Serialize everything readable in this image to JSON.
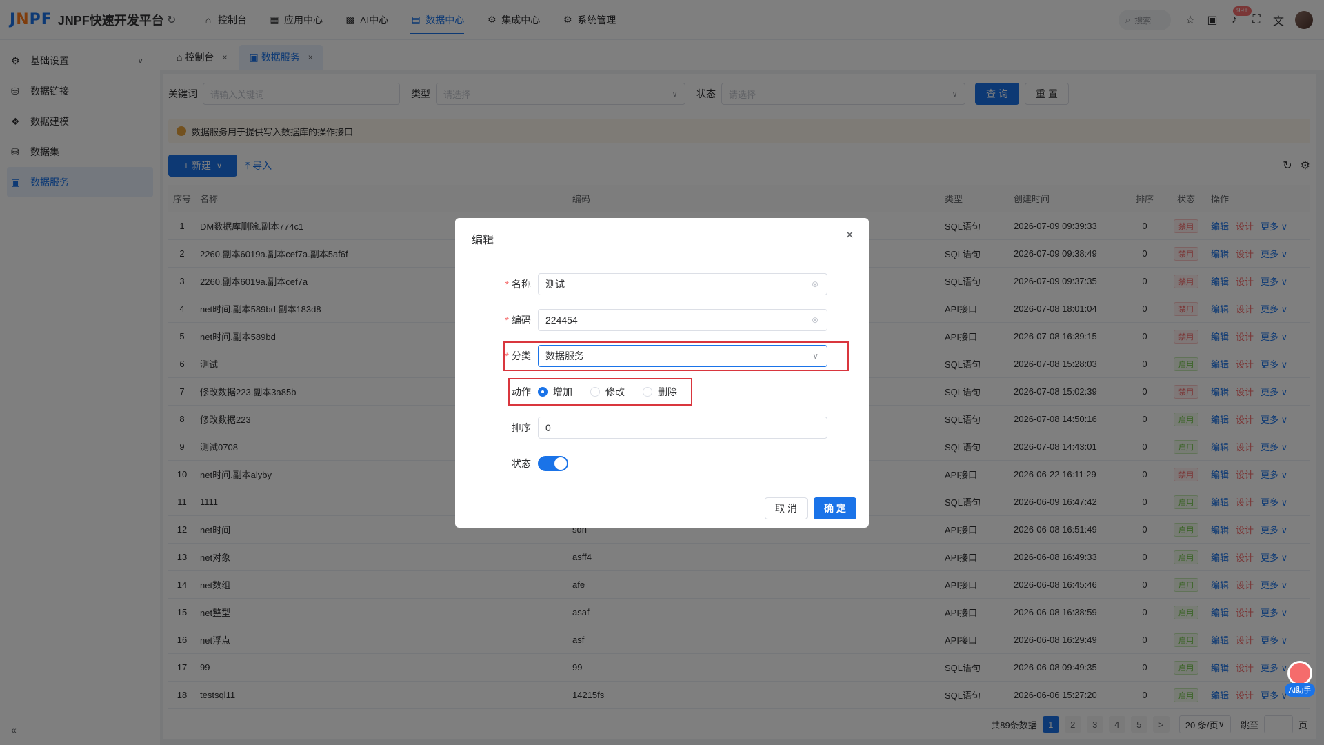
{
  "app": {
    "logo": {
      "j": "J",
      "n": "N",
      "pf": "PF"
    },
    "title": "JNPF快速开发平台"
  },
  "topnav": [
    {
      "label": "控制台",
      "icon": "home-icon",
      "glyph": "⌂"
    },
    {
      "label": "应用中心",
      "icon": "grid-icon",
      "glyph": "▦"
    },
    {
      "label": "AI中心",
      "icon": "ai-grid-icon",
      "glyph": "▩"
    },
    {
      "label": "数据中心",
      "icon": "database-icon",
      "glyph": "▤",
      "active": true
    },
    {
      "label": "集成中心",
      "icon": "integration-icon",
      "glyph": "⚙"
    },
    {
      "label": "系统管理",
      "icon": "gear-icon",
      "glyph": "⚙"
    }
  ],
  "header": {
    "search_placeholder": "搜索",
    "badge": "99+"
  },
  "sidebar": {
    "items": [
      {
        "label": "基础设置",
        "icon": "settings-icon"
      },
      {
        "label": "数据链接",
        "icon": "link-icon"
      },
      {
        "label": "数据建模",
        "icon": "model-icon"
      },
      {
        "label": "数据集",
        "icon": "dataset-icon"
      },
      {
        "label": "数据服务",
        "icon": "service-icon",
        "active": true
      }
    ]
  },
  "tabs": [
    {
      "label": "控制台",
      "close": "×"
    },
    {
      "label": "数据服务",
      "close": "×",
      "active": true
    }
  ],
  "filter": {
    "keyword_label": "关键词",
    "keyword_placeholder": "请输入关键词",
    "type_label": "类型",
    "type_placeholder": "请选择",
    "status_label": "状态",
    "status_placeholder": "请选择",
    "query_label": "查 询",
    "reset_label": "重 置"
  },
  "notice": "数据服务用于提供写入数据库的操作接口",
  "toolbar": {
    "new_label": "+ 新建",
    "import_label": "导入"
  },
  "table": {
    "headers": [
      "序号",
      "名称",
      "编码",
      "类型",
      "创建时间",
      "排序",
      "状态",
      "操作"
    ],
    "ops": {
      "edit": "编辑",
      "design": "设计",
      "more": "更多"
    },
    "rows": [
      {
        "idx": "1",
        "name": "DM数据库删除.副本774c1",
        "code": "",
        "type": "SQL语句",
        "time": "2026-07-09 09:39:33",
        "sort": "0",
        "status": "禁用"
      },
      {
        "idx": "2",
        "name": "2260.副本6019a.副本cef7a.副本5af6f",
        "code": "",
        "type": "SQL语句",
        "time": "2026-07-09 09:38:49",
        "sort": "0",
        "status": "禁用"
      },
      {
        "idx": "3",
        "name": "2260.副本6019a.副本cef7a",
        "code": "",
        "type": "SQL语句",
        "time": "2026-07-09 09:37:35",
        "sort": "0",
        "status": "禁用"
      },
      {
        "idx": "4",
        "name": "net时间.副本589bd.副本183d8",
        "code": "",
        "type": "API接口",
        "time": "2026-07-08 18:01:04",
        "sort": "0",
        "status": "禁用"
      },
      {
        "idx": "5",
        "name": "net时间.副本589bd",
        "code": "",
        "type": "API接口",
        "time": "2026-07-08 16:39:15",
        "sort": "0",
        "status": "禁用"
      },
      {
        "idx": "6",
        "name": "测试",
        "code": "",
        "type": "SQL语句",
        "time": "2026-07-08 15:28:03",
        "sort": "0",
        "status": "启用"
      },
      {
        "idx": "7",
        "name": "修改数据223.副本3a85b",
        "code": "",
        "type": "SQL语句",
        "time": "2026-07-08 15:02:39",
        "sort": "0",
        "status": "禁用"
      },
      {
        "idx": "8",
        "name": "修改数据223",
        "code": "",
        "type": "SQL语句",
        "time": "2026-07-08 14:50:16",
        "sort": "0",
        "status": "启用"
      },
      {
        "idx": "9",
        "name": "测试0708",
        "code": "",
        "type": "SQL语句",
        "time": "2026-07-08 14:43:01",
        "sort": "0",
        "status": "启用"
      },
      {
        "idx": "10",
        "name": "net时间.副本alyby",
        "code": "",
        "type": "API接口",
        "time": "2026-06-22 16:11:29",
        "sort": "0",
        "status": "禁用"
      },
      {
        "idx": "11",
        "name": "1111",
        "code": "",
        "type": "SQL语句",
        "time": "2026-06-09 16:47:42",
        "sort": "0",
        "status": "启用"
      },
      {
        "idx": "12",
        "name": "net时间",
        "code": "sdh",
        "type": "API接口",
        "time": "2026-06-08 16:51:49",
        "sort": "0",
        "status": "启用"
      },
      {
        "idx": "13",
        "name": "net对象",
        "code": "asff4",
        "type": "API接口",
        "time": "2026-06-08 16:49:33",
        "sort": "0",
        "status": "启用"
      },
      {
        "idx": "14",
        "name": "net数组",
        "code": "afe",
        "type": "API接口",
        "time": "2026-06-08 16:45:46",
        "sort": "0",
        "status": "启用"
      },
      {
        "idx": "15",
        "name": "net整型",
        "code": "asaf",
        "type": "API接口",
        "time": "2026-06-08 16:38:59",
        "sort": "0",
        "status": "启用"
      },
      {
        "idx": "16",
        "name": "net浮点",
        "code": "asf",
        "type": "API接口",
        "time": "2026-06-08 16:29:49",
        "sort": "0",
        "status": "启用"
      },
      {
        "idx": "17",
        "name": "99",
        "code": "99",
        "type": "SQL语句",
        "time": "2026-06-08 09:49:35",
        "sort": "0",
        "status": "启用"
      },
      {
        "idx": "18",
        "name": "testsql11",
        "code": "14215fs",
        "type": "SQL语句",
        "time": "2026-06-06 15:27:20",
        "sort": "0",
        "status": "启用"
      }
    ]
  },
  "pager": {
    "total": "共89条数据",
    "pages": [
      "1",
      "2",
      "3",
      "4",
      "5"
    ],
    "next": ">",
    "size": "20 条/页",
    "jump_label": "跳至",
    "page_unit": "页"
  },
  "dialog": {
    "title": "编辑",
    "name_label": "名称",
    "name_value": "测试",
    "code_label": "编码",
    "code_value": "224454",
    "category_label": "分类",
    "category_value": "数据服务",
    "action_label": "动作",
    "actions": [
      "增加",
      "修改",
      "删除"
    ],
    "sort_label": "排序",
    "sort_value": "0",
    "status_label": "状态",
    "cancel_label": "取 消",
    "ok_label": "确 定"
  },
  "ai_helper": "AI助手",
  "colors": {
    "primary": "#1a73e8",
    "danger": "#f56c6c",
    "success": "#67c23a",
    "highlight": "#d9363e"
  }
}
